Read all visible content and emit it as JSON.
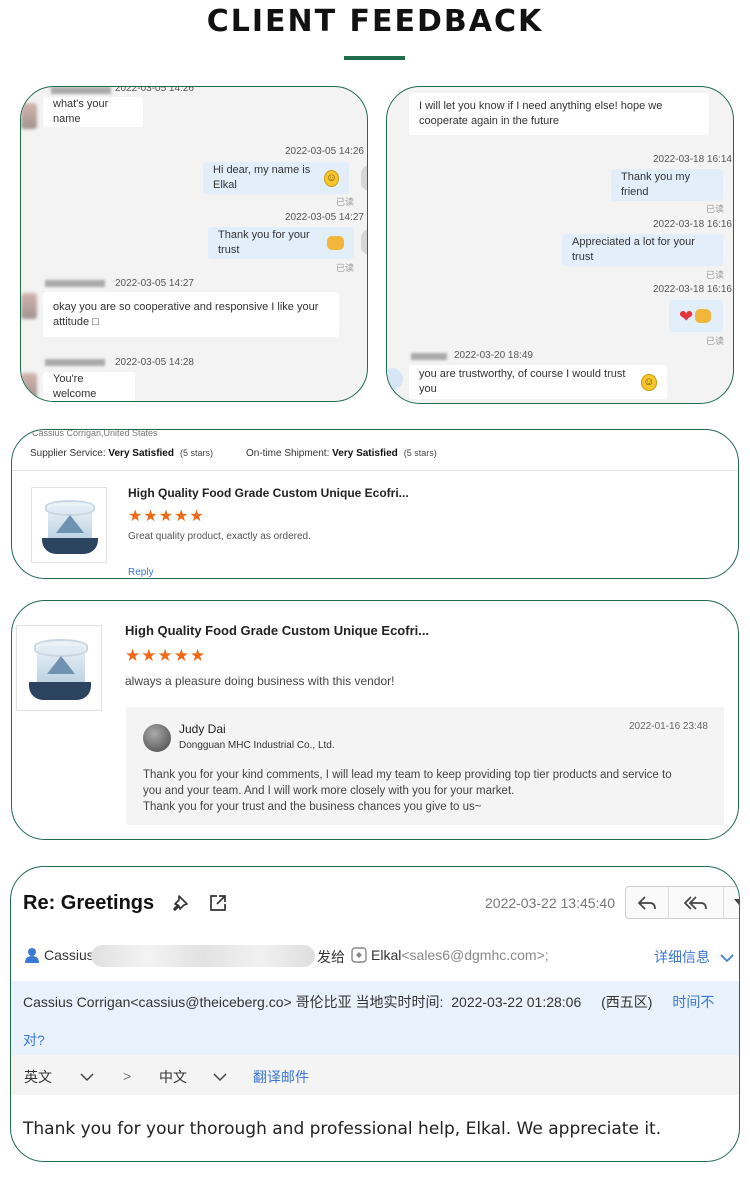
{
  "page": {
    "title": "CLIENT FEEDBACK"
  },
  "chat1": {
    "messages": [
      {
        "time": "2022-03-05 14:26",
        "text": "what's your name"
      },
      {
        "time": "2022-03-05 14:26",
        "text": "Hi dear, my name is Elkal",
        "read": "已读"
      },
      {
        "time": "2022-03-05 14:27",
        "text": "Thank you for your trust",
        "read": "已读"
      },
      {
        "time": "2022-03-05 14:27",
        "text": "okay you are so cooperative and responsive I like your attitude ",
        "glyph": "□"
      },
      {
        "time": "2022-03-05 14:28",
        "text": "You're welcome"
      }
    ]
  },
  "chat2": {
    "messages": [
      {
        "text": "I will let you know if I need anything else! hope we cooperate again in the future"
      },
      {
        "time": "2022-03-18 16:14",
        "text": "Thank you my friend",
        "read": "已读"
      },
      {
        "time": "2022-03-18 16:16",
        "text": "Appreciated a lot for your trust",
        "read": "已读"
      },
      {
        "time": "2022-03-18 16:16",
        "read": "已读"
      },
      {
        "time": "2022-03-20 18:49",
        "text": "you are trustworthy, of course I would trust you"
      }
    ]
  },
  "review1": {
    "reviewer": "Cassius Corrigan,United States",
    "supplier_label": "Supplier Service:",
    "supplier_value": "Very Satisfied",
    "supplier_stars": "(5 stars)",
    "shipment_label": "On-time Shipment:",
    "shipment_value": "Very Satisfied",
    "shipment_stars": "(5 stars)",
    "product_title": "High Quality Food Grade Custom Unique Ecofri...",
    "rating": 5,
    "stars": "★★★★★",
    "comment": "Great quality product, exactly as ordered.",
    "reply_link": "Reply"
  },
  "review2": {
    "product_title": "High Quality Food Grade Custom Unique Ecofri...",
    "rating": 5,
    "stars": "★★★★★",
    "comment": "always a pleasure doing business with this vendor!",
    "reply": {
      "name": "Judy Dai",
      "company": "Dongguan MHC Industrial Co., Ltd.",
      "date": "2022-01-16 23:48",
      "lines": [
        "Thank you for your kind comments, I will lead my team to keep providing top tier products and service to",
        "you and your team. And I will work more closely with you for your market.",
        "Thank you for your trust and the business chances you give to us~"
      ]
    }
  },
  "email": {
    "subject": "Re: Greetings",
    "datetime": "2022-03-22 13:45:40",
    "sender_name": "Cassius",
    "sent_to": "发给",
    "recipient_name": "Elkal",
    "recipient_email": "<sales6@dgmhc.com>;",
    "details_link": "详细信息",
    "notice_sender": "Cassius Corrigan<cassius@theiceberg.co>",
    "notice_location": "哥伦比亚 当地实时时间:",
    "notice_time": "2022-03-22 01:28:06",
    "notice_zone": "(西五区)",
    "notice_link_1": "时间不",
    "notice_link_2": "对?",
    "source_lang": "英文",
    "arrow": ">",
    "target_lang": "中文",
    "translate_link": "翻译邮件",
    "body": "Thank you for your thorough and professional help, Elkal. We appreciate it."
  },
  "icons": [
    "pin-icon",
    "open-external-icon",
    "reply-icon",
    "reply-all-icon",
    "more-icon",
    "user-icon",
    "contact-icon",
    "chevron-down-icon"
  ],
  "colors": {
    "frame_border": "#1f6b4a",
    "star": "#ef6a18",
    "link": "#3c77d6",
    "my_bubble": "#e2effb"
  }
}
